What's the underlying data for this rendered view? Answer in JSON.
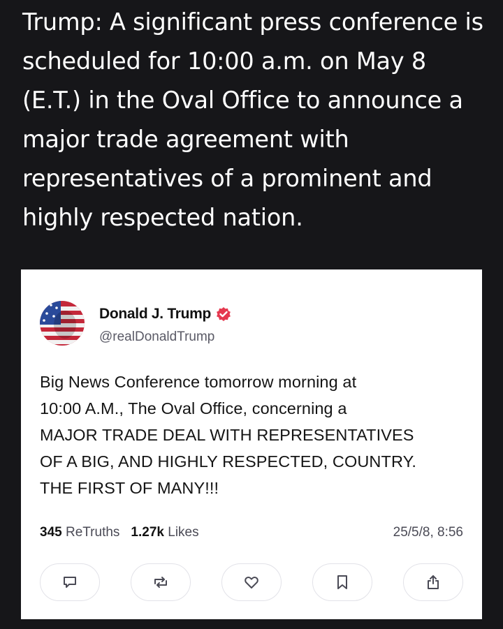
{
  "headline": "Trump: A significant press conference is scheduled for 10:00 a.m. on May 8 (E.T.) in the Oval Office to announce a major trade agreement with representatives of a prominent and highly respected nation.",
  "post": {
    "author_name": "Donald J. Trump",
    "handle": "@realDonaldTrump",
    "verified_icon": "verified-badge-icon",
    "body_lines": [
      "Big News Conference tomorrow morning at",
      "10:00 A.M., The Oval Office, concerning a",
      "MAJOR TRADE DEAL WITH REPRESENTATIVES",
      "OF A BIG, AND HIGHLY RESPECTED, COUNTRY.",
      "THE FIRST OF MANY!!!"
    ],
    "retruths_count": "345",
    "retruths_label": "ReTruths",
    "likes_count": "1.27k",
    "likes_label": "Likes",
    "timestamp": "25/5/8, 8:56"
  },
  "actions": [
    {
      "name": "reply",
      "icon": "comment-icon"
    },
    {
      "name": "retruth",
      "icon": "repost-icon"
    },
    {
      "name": "like",
      "icon": "heart-icon"
    },
    {
      "name": "bookmark",
      "icon": "bookmark-icon"
    },
    {
      "name": "share",
      "icon": "share-icon"
    }
  ],
  "colors": {
    "background": "#161619",
    "card": "#ffffff",
    "verified": "#e5384f",
    "icon": "#4a4a55"
  }
}
